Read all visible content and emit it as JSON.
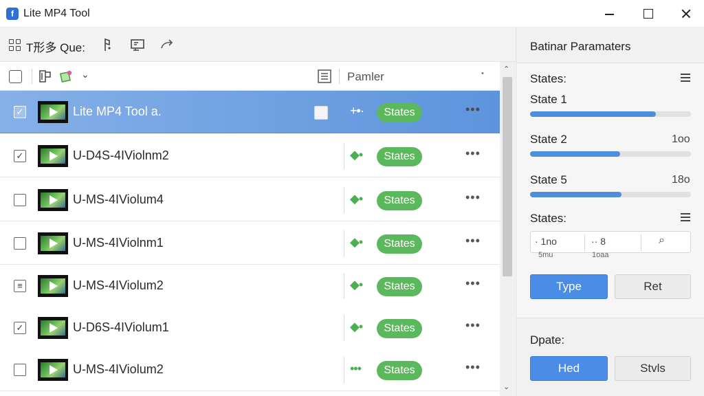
{
  "app": {
    "title": "Lite MP4 Tool",
    "logo": "f"
  },
  "toolbar": {
    "title": "T形多 Que:"
  },
  "list_header": {
    "column_label": "Pamler",
    "sort_glyph": "•",
    "chevron": "⌄"
  },
  "rows": [
    {
      "name": "Lite MP4 Tool a.",
      "checked": "✓",
      "marker": "+•·",
      "state": "States",
      "more": "•••",
      "selected": true
    },
    {
      "name": "U-D4S-4IViolnm2",
      "checked": "✓",
      "marker": "◆•",
      "state": "States",
      "more": "•••",
      "selected": false
    },
    {
      "name": "U-MS-4IViolum4",
      "checked": "",
      "marker": "◆•",
      "state": "States",
      "more": "•••",
      "selected": false
    },
    {
      "name": "U-MS-4IViolnm1",
      "checked": "",
      "marker": "◆•",
      "state": "States",
      "more": "•••",
      "selected": false
    },
    {
      "name": "U-MS-4IViolum2",
      "checked": "≡",
      "marker": "◆•",
      "state": "States",
      "more": "•••",
      "selected": false
    },
    {
      "name": "U-D6S-4IViolum1",
      "checked": "✓",
      "marker": "◆•",
      "state": "States",
      "more": "•••",
      "selected": false
    },
    {
      "name": "U-MS-4IViolum2",
      "checked": "",
      "marker": "•••",
      "state": "States",
      "more": "•••",
      "selected": false
    }
  ],
  "scroll": {
    "up": "⌃",
    "down": "⌄"
  },
  "panel": {
    "title": "Batinar Paramaters",
    "states_label": "States:",
    "sliders": [
      {
        "label": "State 1",
        "value": "",
        "fill": 0.78
      },
      {
        "label": "State 2",
        "value": "1oo",
        "fill": 0.56
      },
      {
        "label": "State 5",
        "value": "18o",
        "fill": 0.57
      }
    ],
    "states_label_2": "States:",
    "inputs": [
      {
        "value": "· 1no",
        "caption": "5mu"
      },
      {
        "value": "·· 8",
        "caption": "1oaa"
      },
      {
        "value": "⌕",
        "caption": ""
      }
    ],
    "primary_btn": "Type",
    "secondary_btn": "Ret",
    "update_label": "Dpate:",
    "primary_btn_2": "Hed",
    "secondary_btn_2": "Stvls"
  }
}
